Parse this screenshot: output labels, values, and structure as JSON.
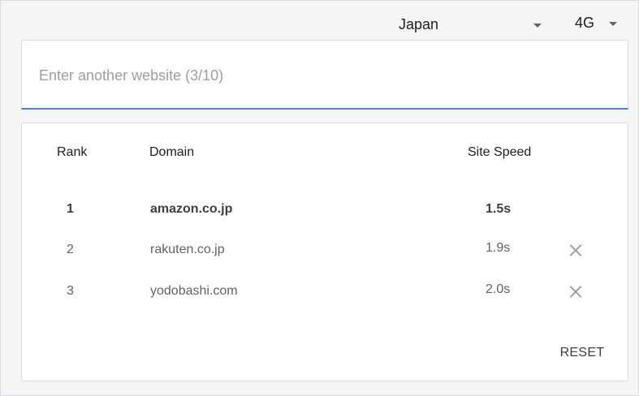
{
  "filters": {
    "country": "Japan",
    "network": "4G"
  },
  "search": {
    "placeholder": "Enter another website (3/10)",
    "value": ""
  },
  "table": {
    "headers": {
      "rank": "Rank",
      "domain": "Domain",
      "speed": "Site Speed"
    },
    "rows": [
      {
        "rank": "1",
        "domain": "amazon.co.jp",
        "speed": "1.5s"
      },
      {
        "rank": "2",
        "domain": "rakuten.co.jp",
        "speed": "1.9s"
      },
      {
        "rank": "3",
        "domain": "yodobashi.com",
        "speed": "2.0s"
      }
    ]
  },
  "actions": {
    "reset_label": "RESET"
  },
  "colors": {
    "accent_underline": "#4a7fd8",
    "remove_icon": "#9aa0a6"
  }
}
